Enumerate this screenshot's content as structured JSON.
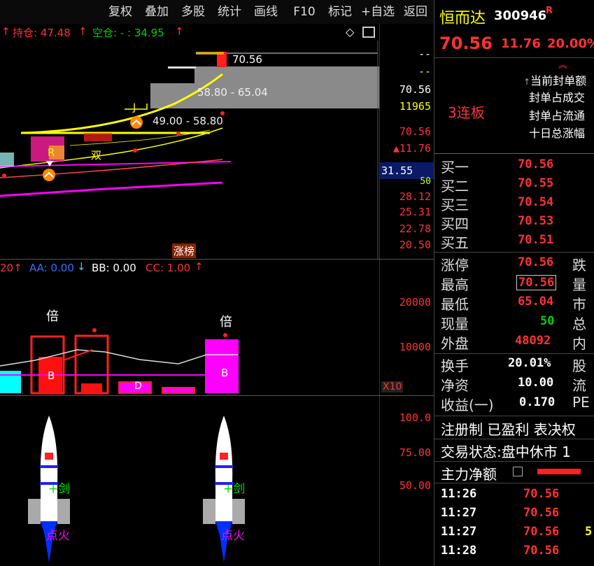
{
  "toolbar": {
    "buttons": [
      "复权",
      "叠加",
      "多股",
      "统计",
      "画线",
      "F10",
      "标记",
      "+自选",
      "返回"
    ]
  },
  "stock": {
    "name": "恒而达",
    "code": "300946",
    "flag": "R",
    "price": "70.56",
    "change": "11.76",
    "change_pct": "20.00%"
  },
  "main_chart": {
    "legend_hold": "持仓: 47.48",
    "legend_empty": "空仓: - : 34.95",
    "box_labels": {
      "top": "70.56",
      "mid": "58.80 - 65.04",
      "low": "49.00 - 58.80"
    },
    "marker_R": "R",
    "marker_shuang": "双",
    "marker_J": "J",
    "zhangbang": "涨榜",
    "y_axis": [
      "28.12",
      "25.31",
      "22.78",
      "20.50"
    ],
    "right_info": {
      "dash1": "--",
      "dash2": "--",
      "price": "70.56",
      "volume": "11965",
      "price2": "70.56",
      "change": "▲11.76",
      "cross_label": "31.55",
      "small": "50"
    }
  },
  "limit_info": {
    "lines": [
      "当前封单额",
      "封单占成交",
      "封单占流通",
      "十日总涨幅"
    ],
    "lianban": "3连板"
  },
  "volume_panel": {
    "legend_prefix": "20",
    "aa": "AA: 0.00",
    "bb": "BB: 0.00",
    "cc": "CC: 1.00",
    "y_axis": [
      "20000",
      "10000"
    ],
    "unit": "X10",
    "bei": "倍",
    "bar_labels": [
      "B",
      "B",
      "D",
      "B"
    ]
  },
  "rocket_panel": {
    "y_axis": [
      "100.0",
      "75.00",
      "50.00"
    ],
    "jian": "剑",
    "dianhuo": "点火"
  },
  "order_book": [
    {
      "label": "买一",
      "price": "70.56"
    },
    {
      "label": "买二",
      "price": "70.55"
    },
    {
      "label": "买三",
      "price": "70.54"
    },
    {
      "label": "买四",
      "price": "70.53"
    },
    {
      "label": "买五",
      "price": "70.51"
    }
  ],
  "stats": [
    {
      "label": "涨停",
      "value": "70.56",
      "label2": "跌"
    },
    {
      "label": "最高",
      "value": "70.56",
      "label2": "量"
    },
    {
      "label": "最低",
      "value": "65.04",
      "label2": "市"
    },
    {
      "label": "现量",
      "value": "50",
      "label2": "总"
    },
    {
      "label": "外盘",
      "value": "48092",
      "label2": "内"
    }
  ],
  "stats2": [
    {
      "label": "换手",
      "value": "20.01%",
      "label2": "股"
    },
    {
      "label": "净资",
      "value": "10.00",
      "label2": "流"
    },
    {
      "label": "收益(一)",
      "value": "0.170",
      "label2": "PE"
    }
  ],
  "tags": "注册制 已盈利 表决权",
  "trade_status": "交易状态:盘中休市 1",
  "main_force": "主力净额",
  "ticks": [
    {
      "time": "11:26",
      "price": "70.56",
      "vol": ""
    },
    {
      "time": "11:27",
      "price": "70.56",
      "vol": ""
    },
    {
      "time": "11:27",
      "price": "70.56",
      "vol": "5"
    },
    {
      "time": "11:28",
      "price": "70.56",
      "vol": ""
    }
  ],
  "colors": {
    "up": "#ff3232",
    "down": "#00d200",
    "accent": "#ffff00",
    "magenta": "#ff00ff",
    "bg": "#000000"
  }
}
